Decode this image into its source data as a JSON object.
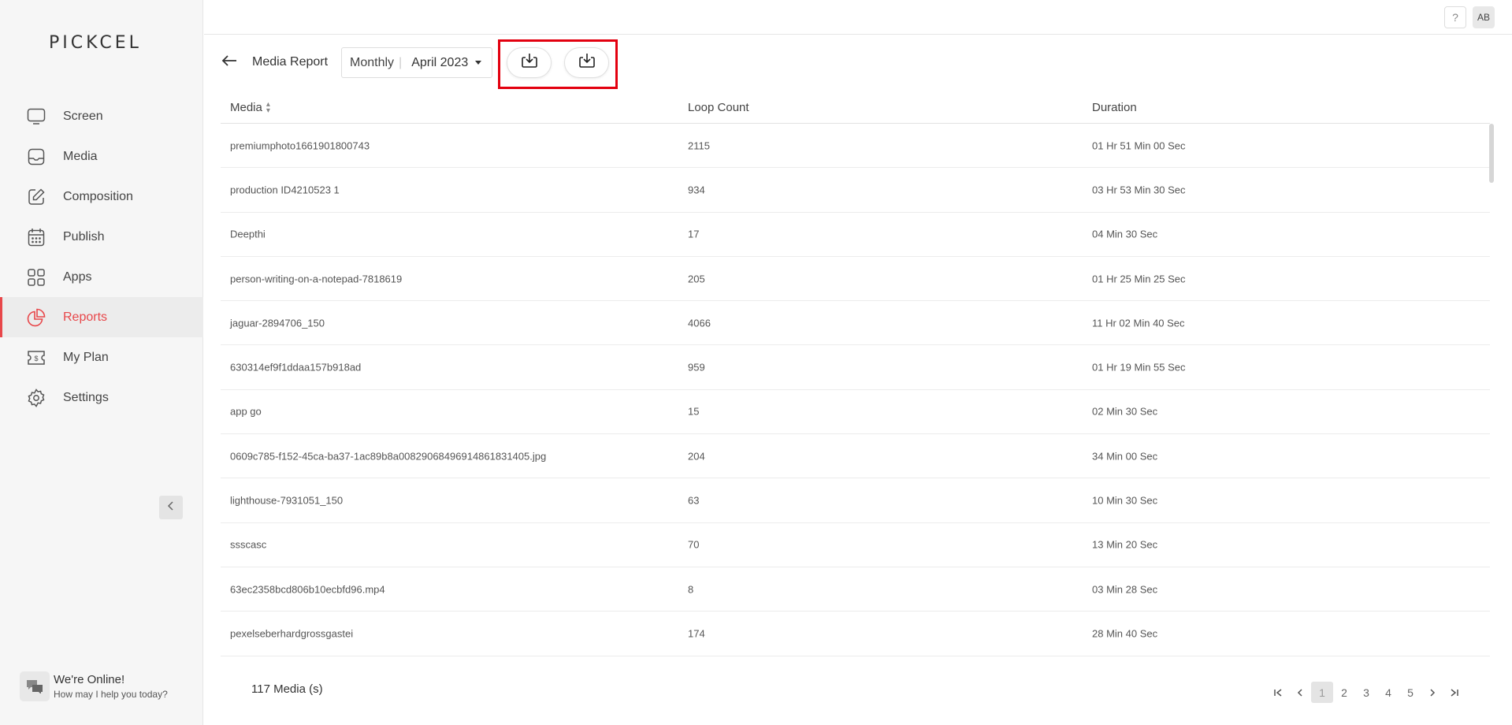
{
  "brand": {
    "logo_text": "PICKCEL"
  },
  "sidebar": {
    "items": [
      {
        "label": "Screen",
        "icon": "monitor-icon",
        "active": false
      },
      {
        "label": "Media",
        "icon": "media-folder-icon",
        "active": false
      },
      {
        "label": "Composition",
        "icon": "edit-icon",
        "active": false
      },
      {
        "label": "Publish",
        "icon": "calendar-icon",
        "active": false
      },
      {
        "label": "Apps",
        "icon": "apps-grid-icon",
        "active": false
      },
      {
        "label": "Reports",
        "icon": "pie-chart-icon",
        "active": true
      },
      {
        "label": "My Plan",
        "icon": "ticket-icon",
        "active": false
      },
      {
        "label": "Settings",
        "icon": "gear-icon",
        "active": false
      }
    ],
    "collapse_icon": "chevron-left-icon",
    "chat": {
      "title": "We're Online!",
      "subtitle": "How may I help you today?"
    }
  },
  "topbar": {
    "help_label": "?",
    "avatar_initials": "AB"
  },
  "header": {
    "title": "Media Report",
    "period_mode": "Monthly",
    "period_value": "April 2023",
    "download_icons": [
      "download-icon",
      "download-icon"
    ]
  },
  "table": {
    "columns": [
      "Media",
      "Loop Count",
      "Duration"
    ],
    "rows": [
      [
        "premiumphoto1661901800743",
        "2115",
        "01 Hr 51 Min 00 Sec"
      ],
      [
        "production ID4210523 1",
        "934",
        "03 Hr 53 Min 30 Sec"
      ],
      [
        "Deepthi",
        "17",
        "04 Min 30 Sec"
      ],
      [
        "person-writing-on-a-notepad-7818619",
        "205",
        "01 Hr 25 Min 25 Sec"
      ],
      [
        "jaguar-2894706_150",
        "4066",
        "11 Hr 02 Min 40 Sec"
      ],
      [
        "630314ef9f1ddaa157b918ad",
        "959",
        "01 Hr 19 Min 55 Sec"
      ],
      [
        "app go",
        "15",
        "02 Min 30 Sec"
      ],
      [
        "0609c785-f152-45ca-ba37-1ac89b8a0082906849691486183140​5.jpg",
        "204",
        "34 Min 00 Sec"
      ],
      [
        "lighthouse-7931051_150",
        "63",
        "10 Min 30 Sec"
      ],
      [
        "ssscasc",
        "70",
        "13 Min 20 Sec"
      ],
      [
        "63ec2358bcd806b10ecbfd96.mp4",
        "8",
        "03 Min 28 Sec"
      ],
      [
        "pexelseberhardgrossgastei",
        "174",
        "28 Min 40 Sec"
      ],
      [
        "",
        "",
        ""
      ]
    ]
  },
  "footer": {
    "count_label": "117 Media (s)",
    "pages": [
      "1",
      "2",
      "3",
      "4",
      "5"
    ],
    "current_page": "1"
  }
}
